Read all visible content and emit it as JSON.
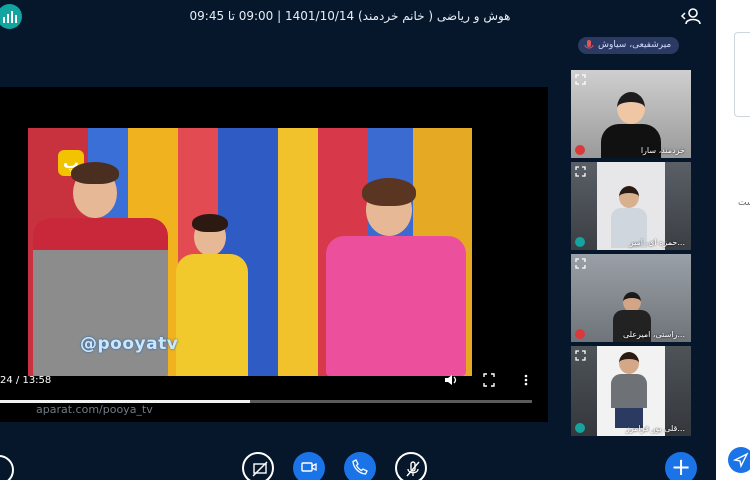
{
  "header": {
    "title": "هوش و ریاضی ( خانم خردمند) 1401/10/14 | 09:00 تا 09:45"
  },
  "presenter": {
    "name": "میرشفیعی، سیاوش"
  },
  "video": {
    "watermark": "@pooyatv",
    "logo_text": "پ",
    "time_display": "24 / 13:58",
    "caption": "aparat.com/pooya_tv",
    "progress_percent": 47
  },
  "participants": [
    {
      "name": "خردمند، سارا",
      "status": "muted"
    },
    {
      "name": "حمزه ای، امیر...",
      "status": "listen"
    },
    {
      "name": "راستی، امیرعلی...",
      "status": "muted"
    },
    {
      "name": "قلی پور فرامرز...",
      "status": "listen"
    }
  ],
  "colors": {
    "background": "#06172b",
    "accent": "#1b73e8",
    "teal": "#14a4a0",
    "muted_red": "#d8393b"
  },
  "controls": {
    "screenshare": "screenshare-off-icon",
    "camera": "camera-icon",
    "phone": "phone-icon",
    "mic": "mic-off-icon",
    "plus": "+"
  },
  "side_panel": {
    "fragment": "ست"
  }
}
